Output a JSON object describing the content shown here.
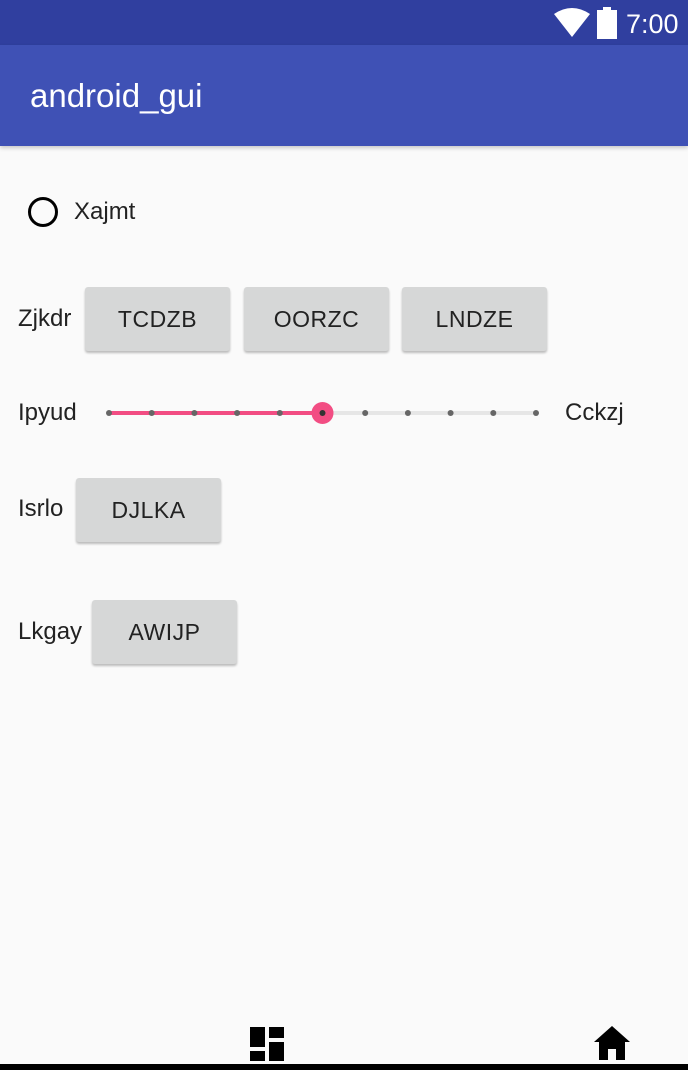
{
  "status_bar": {
    "time": "7:00",
    "icons": [
      "wifi-icon",
      "battery-icon"
    ]
  },
  "app_bar": {
    "title": "android_gui"
  },
  "radio": {
    "label": "Xajmt",
    "checked": false
  },
  "row1": {
    "label": "Zjkdr",
    "buttons": [
      "TCDZB",
      "OORZC",
      "LNDZE"
    ]
  },
  "slider": {
    "left_label": "Ipyud",
    "right_label": "Cckzj",
    "steps": 10,
    "value": 5,
    "accent_color": "#f24d83"
  },
  "row3": {
    "label": "Isrlo",
    "button": "DJLKA"
  },
  "row4": {
    "label": "Lkgay",
    "button": "AWIJP"
  },
  "nav": {
    "icons": [
      "dashboard-icon",
      "home-icon"
    ]
  },
  "colors": {
    "status_bar": "#303f9f",
    "app_bar": "#3f51b5",
    "background": "#fafafa",
    "button": "#d6d7d7"
  }
}
